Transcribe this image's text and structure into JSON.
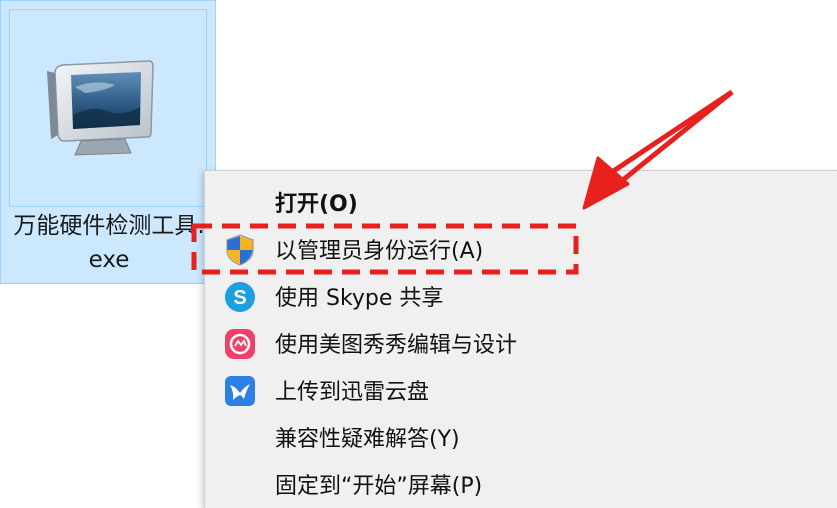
{
  "desktop_icon": {
    "name": "万能硬件检测工具.exe",
    "icon": "monitor-icon",
    "selected": true
  },
  "context_menu": {
    "items": [
      {
        "label": "打开(O)",
        "icon": "",
        "bold": true
      },
      {
        "label": "以管理员身份运行(A)",
        "icon": "uac-shield-icon"
      },
      {
        "label": "使用 Skype 共享",
        "icon": "skype-icon"
      },
      {
        "label": "使用美图秀秀编辑与设计",
        "icon": "meitu-icon"
      },
      {
        "label": "上传到迅雷云盘",
        "icon": "xunlei-icon"
      },
      {
        "label": "兼容性疑难解答(Y)",
        "icon": ""
      },
      {
        "label": "固定到“开始”屏幕(P)",
        "icon": ""
      }
    ]
  },
  "annotation": {
    "highlight_color": "#e8201e",
    "target": "以管理员身份运行(A)"
  },
  "colors": {
    "selection_bg": "#cce8ff",
    "menu_bg": "#f0f0f0",
    "skype": "#1ea0e0",
    "meitu": "#f0406a",
    "xunlei": "#2d7fe8"
  }
}
